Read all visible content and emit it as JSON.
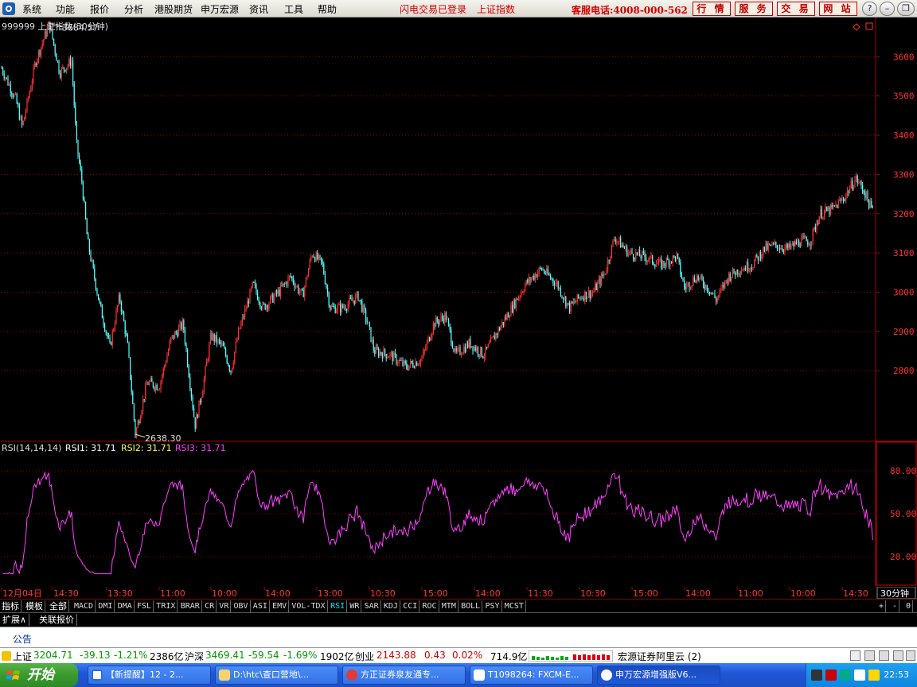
{
  "menubar": {
    "items": [
      "系统",
      "功能",
      "报价",
      "分析",
      "港股期货",
      "申万宏源",
      "资讯",
      "工具",
      "帮助"
    ],
    "status_login": "闪电交易已登录",
    "status_index": "上证指数",
    "hotline": "客服电话:4008-000-562",
    "buttons": [
      "行 情",
      "服 务",
      "交 易",
      "网 站"
    ],
    "window_buttons": [
      "?",
      "–",
      "❐",
      "✕"
    ]
  },
  "chart_header": {
    "title": "999999 上证指数(30分钟)",
    "high_label": "3684.57",
    "low_label": "2638.30"
  },
  "rsi_header": {
    "name": "RSI(14,14,14)",
    "rsi1": "RSI1: 31.71",
    "rsi2": "RSI2: 31.71",
    "rsi3": "RSI3: 31.71"
  },
  "chart_data": {
    "type": "candlestick",
    "title": "999999 上证指数(30分钟)",
    "price_axis_ticks": [
      2800,
      2900,
      3000,
      3100,
      3200,
      3300,
      3400,
      3500,
      3600
    ],
    "ylim": [
      2620,
      3700
    ],
    "rsi_axis_ticks": [
      "80.00",
      "50.00",
      "20.00"
    ],
    "rsi_ylim": [
      0,
      100
    ],
    "x_tick_labels": [
      "12月04日",
      "14:30",
      "13:30",
      "11:00",
      "10:00",
      "14:00",
      "13:00",
      "10:30",
      "15:00",
      "14:00",
      "11:30",
      "10:30",
      "15:00",
      "14:00",
      "11:00",
      "10:00",
      "14:30"
    ],
    "period_label": "30分钟",
    "close_path_keypoints": [
      [
        0,
        3580
      ],
      [
        20,
        3490
      ],
      [
        28,
        3420
      ],
      [
        45,
        3590
      ],
      [
        62,
        3684.57
      ],
      [
        75,
        3560
      ],
      [
        90,
        3590
      ],
      [
        96,
        3380
      ],
      [
        103,
        3280
      ],
      [
        110,
        3130
      ],
      [
        125,
        2970
      ],
      [
        138,
        2860
      ],
      [
        150,
        2990
      ],
      [
        160,
        2870
      ],
      [
        170,
        2638.3
      ],
      [
        185,
        2770
      ],
      [
        200,
        2760
      ],
      [
        215,
        2880
      ],
      [
        230,
        2920
      ],
      [
        245,
        2660
      ],
      [
        255,
        2760
      ],
      [
        265,
        2890
      ],
      [
        280,
        2860
      ],
      [
        290,
        2800
      ],
      [
        300,
        2900
      ],
      [
        318,
        3020
      ],
      [
        330,
        2960
      ],
      [
        350,
        3000
      ],
      [
        365,
        3040
      ],
      [
        380,
        2990
      ],
      [
        392,
        3100
      ],
      [
        405,
        3070
      ],
      [
        415,
        2960
      ],
      [
        430,
        2960
      ],
      [
        450,
        2990
      ],
      [
        462,
        2920
      ],
      [
        470,
        2850
      ],
      [
        490,
        2840
      ],
      [
        510,
        2810
      ],
      [
        530,
        2830
      ],
      [
        545,
        2920
      ],
      [
        560,
        2940
      ],
      [
        572,
        2840
      ],
      [
        590,
        2870
      ],
      [
        608,
        2840
      ],
      [
        622,
        2890
      ],
      [
        640,
        2950
      ],
      [
        660,
        3020
      ],
      [
        680,
        3060
      ],
      [
        700,
        3020
      ],
      [
        715,
        2960
      ],
      [
        730,
        2990
      ],
      [
        745,
        3000
      ],
      [
        760,
        3050
      ],
      [
        772,
        3140
      ],
      [
        790,
        3100
      ],
      [
        810,
        3090
      ],
      [
        830,
        3070
      ],
      [
        850,
        3090
      ],
      [
        860,
        3010
      ],
      [
        875,
        3040
      ],
      [
        890,
        3010
      ],
      [
        900,
        2980
      ],
      [
        915,
        3040
      ],
      [
        930,
        3060
      ],
      [
        945,
        3070
      ],
      [
        960,
        3110
      ],
      [
        975,
        3120
      ],
      [
        990,
        3110
      ],
      [
        1005,
        3130
      ],
      [
        1018,
        3130
      ],
      [
        1030,
        3200
      ],
      [
        1045,
        3210
      ],
      [
        1060,
        3240
      ],
      [
        1075,
        3290
      ],
      [
        1085,
        3260
      ],
      [
        1095,
        3210
      ]
    ],
    "rsi_series": {
      "name": "RSI1",
      "last": 31.71
    }
  },
  "tabs": {
    "cn": [
      "指标",
      "模板",
      "全部"
    ],
    "indicators": [
      "MACD",
      "DMI",
      "DMA",
      "FSL",
      "TRIX",
      "BRAR",
      "CR",
      "VR",
      "OBV",
      "ASI",
      "EMV",
      "VOL-TDX",
      "RSI",
      "WR",
      "SAR",
      "KDJ",
      "CCI",
      "ROC",
      "MTM",
      "BOLL",
      "PSY",
      "MCST"
    ],
    "active": "RSI",
    "right_controls": [
      "+",
      "-",
      "0"
    ]
  },
  "ext_bar": [
    "扩展∧",
    "关联报价"
  ],
  "notice": "公告",
  "ticker": {
    "sh_name": "上证",
    "sh_value": "3204.71",
    "sh_change": "-39.13",
    "sh_pct": "-1.21%",
    "sh_amount": "2386亿",
    "hs_name": "沪深",
    "hs_value": "3469.41",
    "hs_change": "-59.54",
    "hs_pct": "-1.69%",
    "hs_amount": "1902亿",
    "cy_name": "创业",
    "cy_value": "2143.88",
    "cy_change": "0.43",
    "cy_pct": "0.02%",
    "cy_amount": "714.9亿",
    "broker": "宏源证券阿里云 (2)"
  },
  "taskbar": {
    "start": "开始",
    "tasks": [
      "【新提醒】12 - 2...",
      "D:\\htc\\查口营地\\...",
      "方正证券泉友通专...",
      "T1098264: FXCM-E...",
      "申万宏源增强版V6..."
    ],
    "clock": "22:53"
  },
  "colors": {
    "up": "#ff3232",
    "down": "#54ffff",
    "grid": "#a00000",
    "rsi": "#ff40ff"
  }
}
